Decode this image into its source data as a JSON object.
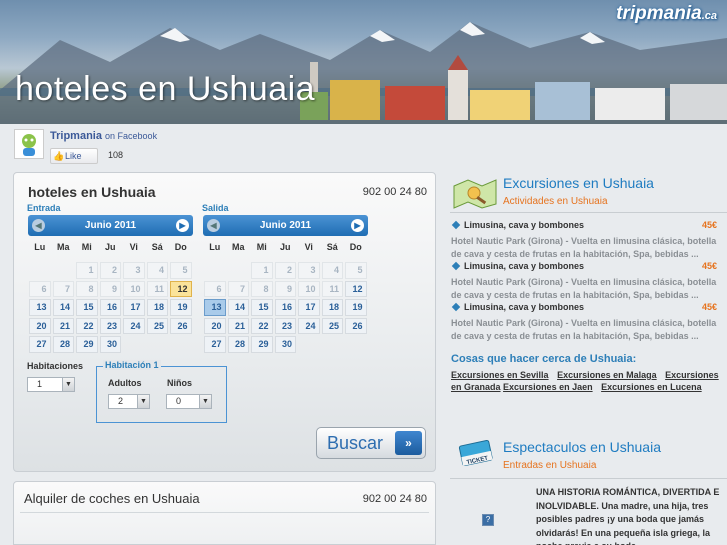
{
  "banner": {
    "title": "hoteles en Ushuaia",
    "logo_main": "tripmania",
    "logo_suffix": ".ca"
  },
  "facebook": {
    "page_name": "Tripmania",
    "on_facebook": "on Facebook",
    "like_label": "Like",
    "like_count": "108"
  },
  "booking": {
    "title": "hoteles en Ushuaia",
    "phone": "902 00 24 80",
    "entrada_label": "Entrada",
    "salida_label": "Salida",
    "calendars": [
      {
        "month": "Junio 2011",
        "prev_icon": "◀",
        "next_icon": "▶"
      },
      {
        "month": "Junio 2011",
        "prev_icon": "◀",
        "next_icon": "▶"
      }
    ],
    "weekdays": [
      "Lu",
      "Ma",
      "Mi",
      "Ju",
      "Vi",
      "Sá",
      "Do"
    ],
    "habitaciones_label": "Habitaciones",
    "habitaciones_value": "1",
    "habitacion1_label": "Habitación 1",
    "adultos_label": "Adultos",
    "adultos_value": "2",
    "ninos_label": "Niños",
    "ninos_value": "0",
    "search_label": "Buscar",
    "search_icon": "»"
  },
  "calendar_days": {
    "leading_empty": 2,
    "days": [
      "1",
      "2",
      "3",
      "4",
      "5",
      "6",
      "7",
      "8",
      "9",
      "10",
      "11",
      "12",
      "13",
      "14",
      "15",
      "16",
      "17",
      "18",
      "19",
      "20",
      "21",
      "22",
      "23",
      "24",
      "25",
      "26",
      "27",
      "28",
      "29",
      "30"
    ],
    "past_until": 11,
    "entrada_selected": "12",
    "salida_selected": "13"
  },
  "cars": {
    "title": "Alquiler de coches en Ushuaia",
    "phone": "902 00 24 80"
  },
  "excursiones": {
    "title": "Excursiones en Ushuaia",
    "subtitle": "Actividades en Ushuaia",
    "items": [
      {
        "name": "Limusina, cava y bombones",
        "price": "45€",
        "desc": "Hotel Nautic Park (Girona) - Vuelta en limusina clásica, botella de cava y cesta de frutas en la habitación, Spa, bebidas ..."
      },
      {
        "name": "Limusina, cava y bombones",
        "price": "45€",
        "desc": "Hotel Nautic Park (Girona) - Vuelta en limusina clásica, botella de cava y cesta de frutas en la habitación, Spa, bebidas ..."
      },
      {
        "name": "Limusina, cava y bombones",
        "price": "45€",
        "desc": "Hotel Nautic Park (Girona) - Vuelta en limusina clásica, botella de cava y cesta de frutas en la habitación, Spa, bebidas ..."
      }
    ]
  },
  "cosas": {
    "title": "Cosas que hacer cerca de Ushuaia:",
    "links": [
      "Excursiones en Sevilla",
      "Excursiones en Malaga",
      "Excursiones en Granada",
      "Excursiones en Jaen",
      "Excursiones en Lucena"
    ]
  },
  "espectaculos": {
    "title": "Espectaculos en Ushuaia",
    "subtitle": "Entradas en Ushuaia",
    "ticket_text": "TICKET",
    "desc": "UNA HISTORIA ROMÁNTICA, DIVERTIDA E INOLVIDABLE. Una madre, una hija, tres posibles padres ¡y una boda que jamás olvidarás! En una pequeña isla griega, la noche previa a su boda...",
    "image_placeholder": "?"
  }
}
